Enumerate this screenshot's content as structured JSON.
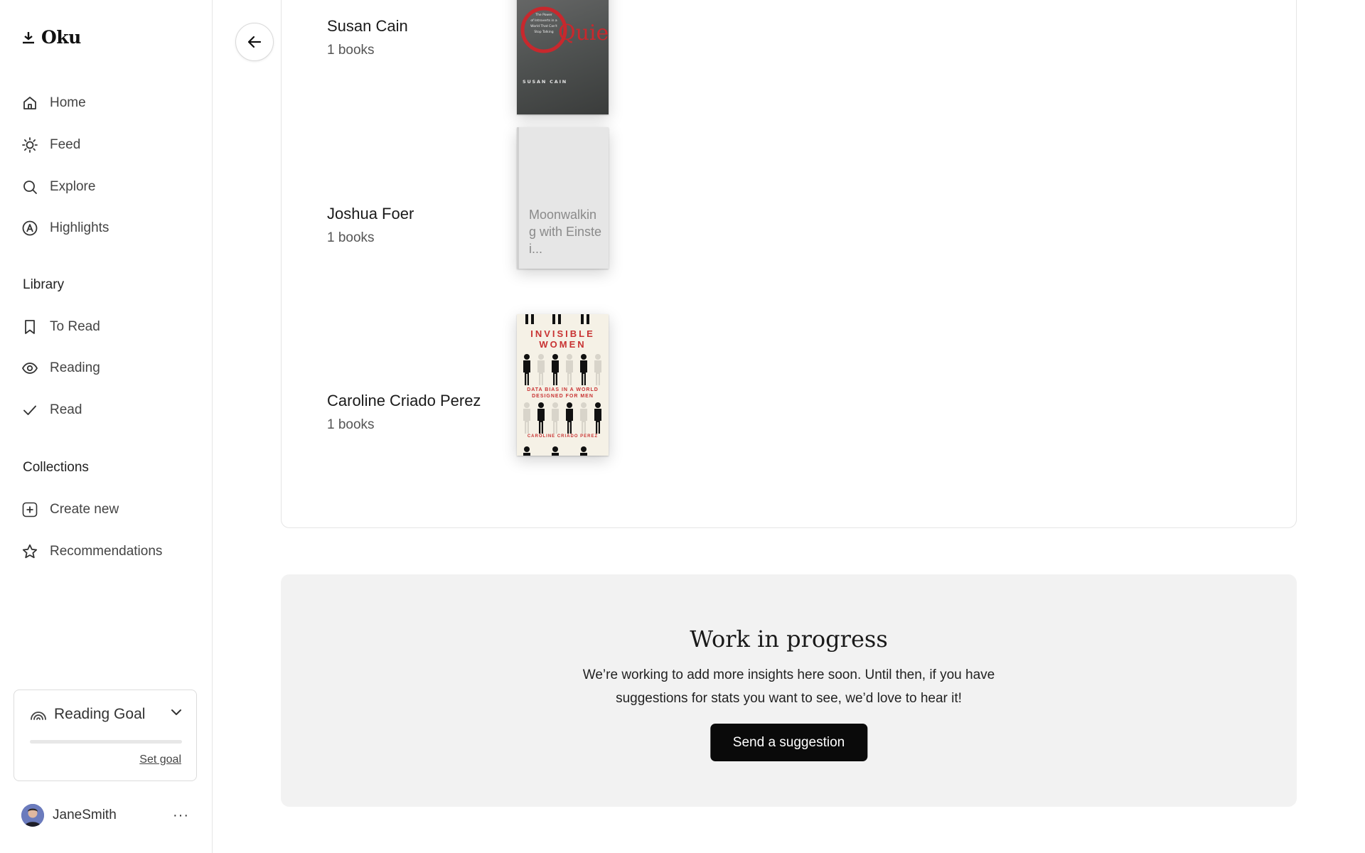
{
  "app": {
    "name": "Oku"
  },
  "nav": {
    "items": [
      {
        "label": "Home",
        "icon": "home-icon"
      },
      {
        "label": "Feed",
        "icon": "sun-icon"
      },
      {
        "label": "Explore",
        "icon": "search-icon"
      },
      {
        "label": "Highlights",
        "icon": "highlight-icon"
      }
    ]
  },
  "library": {
    "heading": "Library",
    "items": [
      {
        "label": "To Read",
        "icon": "bookmark-icon"
      },
      {
        "label": "Reading",
        "icon": "eye-icon"
      },
      {
        "label": "Read",
        "icon": "check-icon"
      }
    ]
  },
  "collections": {
    "heading": "Collections",
    "items": [
      {
        "label": "Create new",
        "icon": "plus-square-icon"
      },
      {
        "label": "Recommendations",
        "icon": "star-icon"
      }
    ]
  },
  "reading_goal": {
    "title": "Reading Goal",
    "link": "Set goal",
    "progress": 0
  },
  "user": {
    "name": "JaneSmith",
    "more": "···"
  },
  "authors": [
    {
      "name": "Susan Cain",
      "count": "1 books",
      "book": {
        "cover_title": "Quiet",
        "cover_subtitle": "The Power of Introverts in a World That Can't Stop Talking",
        "cover_author": "SUSAN CAIN"
      }
    },
    {
      "name": "Joshua Foer",
      "count": "1 books",
      "book": {
        "placeholder_title": "Moonwalking with Einstei..."
      }
    },
    {
      "name": "Caroline Criado Perez",
      "count": "1 books",
      "book": {
        "cover_title_1": "INVISIBLE",
        "cover_title_2": "WOMEN",
        "cover_subtitle_1": "DATA BIAS IN A WORLD",
        "cover_subtitle_2": "DESIGNED FOR MEN",
        "cover_author": "CAROLINE CRIADO PEREZ"
      }
    }
  ],
  "wip": {
    "title": "Work in progress",
    "text": "We’re working to add more insights here soon. Until then, if you have suggestions for stats you want to see, we’d love to hear it!",
    "button": "Send a suggestion"
  },
  "colors": {
    "accent": "#0a0a0a",
    "quiet_red": "#c8282d",
    "iw_red": "#c83232"
  }
}
